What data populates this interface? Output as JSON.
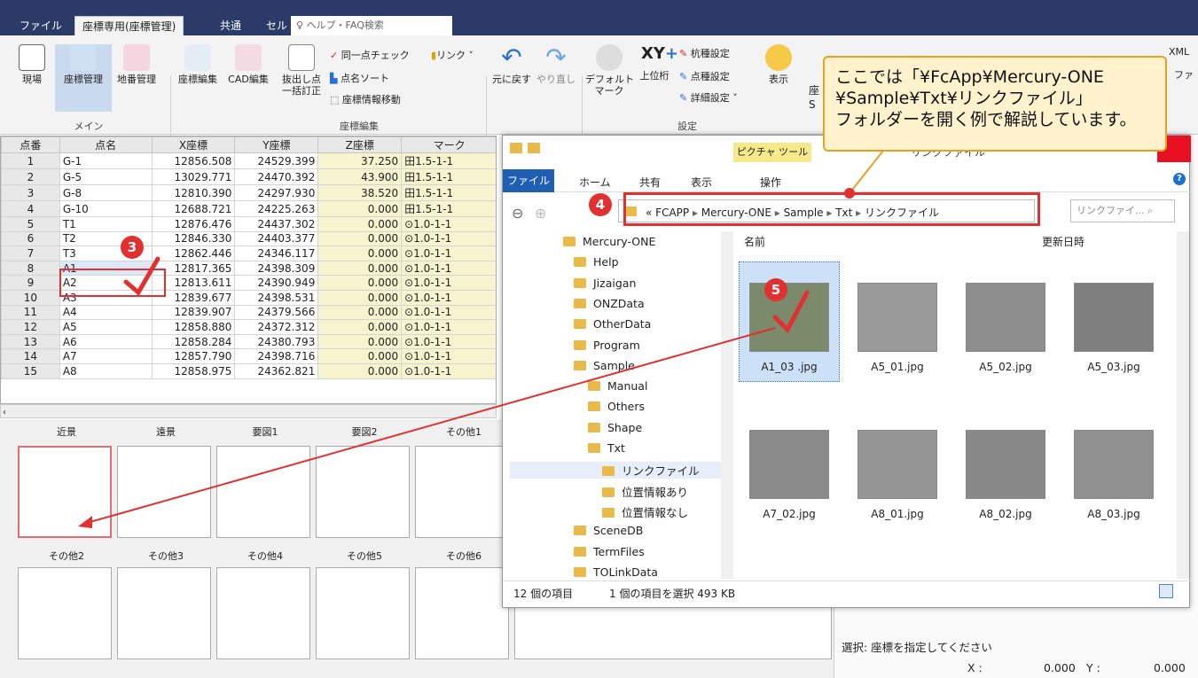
{
  "tabs": [
    "ファイル",
    "座標専用(座標管理)",
    "共通",
    "セル"
  ],
  "search_placeholder": "ヘルプ・FAQ検索",
  "ribbon": {
    "main": [
      "現場",
      "座標管理",
      "地番管理"
    ],
    "main_group": "メイン",
    "edit": [
      "座標編集",
      "CAD編集",
      "抜出し点\n一括訂正"
    ],
    "edit_small": [
      "同一点チェック",
      "リンク",
      "点名ソート",
      "座標情報移動"
    ],
    "edit_group": "座標編集",
    "undo": "元に戻す",
    "redo": "やり直し",
    "default_mark": "デフォルト\nマーク",
    "upper": "上位桁",
    "settings_small": [
      "杭種設定",
      "点種設定",
      "詳細設定"
    ],
    "display": "表示",
    "settings_group": "設定",
    "partial_right": [
      "XML",
      "ファ"
    ],
    "partial_under": [
      "座",
      "S"
    ]
  },
  "table": {
    "headers": [
      "点番",
      "点名",
      "X座標",
      "Y座標",
      "Z座標",
      "マーク"
    ],
    "rows": [
      [
        "1",
        "G-1",
        "12856.508",
        "24529.399",
        "37.250",
        "田1.5-1-1"
      ],
      [
        "2",
        "G-5",
        "13029.771",
        "24470.392",
        "43.900",
        "田1.5-1-1"
      ],
      [
        "3",
        "G-8",
        "12810.390",
        "24297.930",
        "38.520",
        "田1.5-1-1"
      ],
      [
        "4",
        "G-10",
        "12688.721",
        "24225.263",
        "0.000",
        "田1.5-1-1"
      ],
      [
        "5",
        "T1",
        "12876.476",
        "24437.302",
        "0.000",
        "⊙1.0-1-1"
      ],
      [
        "6",
        "T2",
        "12846.330",
        "24403.377",
        "0.000",
        "⊙1.0-1-1"
      ],
      [
        "7",
        "T3",
        "12862.446",
        "24346.117",
        "0.000",
        "⊙1.0-1-1"
      ],
      [
        "8",
        "A1",
        "12817.365",
        "24398.309",
        "0.000",
        "⊙1.0-1-1"
      ],
      [
        "9",
        "A2",
        "12813.611",
        "24390.949",
        "0.000",
        "⊙1.0-1-1"
      ],
      [
        "10",
        "A3",
        "12839.677",
        "24398.531",
        "0.000",
        "⊙1.0-1-1"
      ],
      [
        "11",
        "A4",
        "12839.907",
        "24379.566",
        "0.000",
        "⊙1.0-1-1"
      ],
      [
        "12",
        "A5",
        "12858.880",
        "24372.312",
        "0.000",
        "⊙1.0-1-1"
      ],
      [
        "13",
        "A6",
        "12858.284",
        "24380.793",
        "0.000",
        "⊙1.0-1-1"
      ],
      [
        "14",
        "A7",
        "12857.790",
        "24398.716",
        "0.000",
        "⊙1.0-1-1"
      ],
      [
        "15",
        "A8",
        "12858.975",
        "24362.821",
        "0.000",
        "⊙1.0-1-1"
      ]
    ]
  },
  "photo_labels_row1": [
    "近景",
    "遠景",
    "要図1",
    "要図2",
    "その他1"
  ],
  "photo_labels_row2": [
    "その他2",
    "その他3",
    "その他4",
    "その他5",
    "その他6"
  ],
  "explorer": {
    "title": "リンクファイル",
    "picture_tools": "ピクチャ ツール",
    "tabs": [
      "ファイル",
      "ホーム",
      "共有",
      "表示",
      "操作"
    ],
    "breadcrumb": [
      "«",
      "FCAPP",
      "Mercury-ONE",
      "Sample",
      "Txt",
      "リンクファイル"
    ],
    "search_placeholder": "リンクファイ...",
    "col_name": "名前",
    "col_date": "更新日時",
    "tree": [
      "Mercury-ONE",
      "Help",
      "Jizaigan",
      "ONZData",
      "OtherData",
      "Program",
      "Sample",
      "Manual",
      "Others",
      "Shape",
      "Txt",
      "リンクファイル",
      "位置情報あり",
      "位置情報なし",
      "SceneDB",
      "TermFiles",
      "TOLinkData"
    ],
    "files": [
      "A1_03 .jpg",
      "A5_01.jpg",
      "A5_02.jpg",
      "A5_03.jpg",
      "A7_02.jpg",
      "A8_01.jpg",
      "A8_02.jpg",
      "A8_03.jpg"
    ],
    "status_count": "12 個の項目",
    "status_sel": "1 個の項目を選択  493 KB"
  },
  "callout": [
    "ここでは「¥FcApp¥Mercury-ONE",
    "¥Sample¥Txt¥リンクファイル」",
    "フォルダーを開く例で解説しています。"
  ],
  "status": {
    "select_msg": "選択: 座標を指定してください",
    "x_label": "X :",
    "x_val": "0.000",
    "y_label": "Y :",
    "y_val": "0.000"
  },
  "badges": [
    "3",
    "4",
    "5"
  ],
  "colors": {
    "tabbar": "#2b3a67",
    "accent_red": "#e03030",
    "callout_bg": "#fff2cc"
  }
}
